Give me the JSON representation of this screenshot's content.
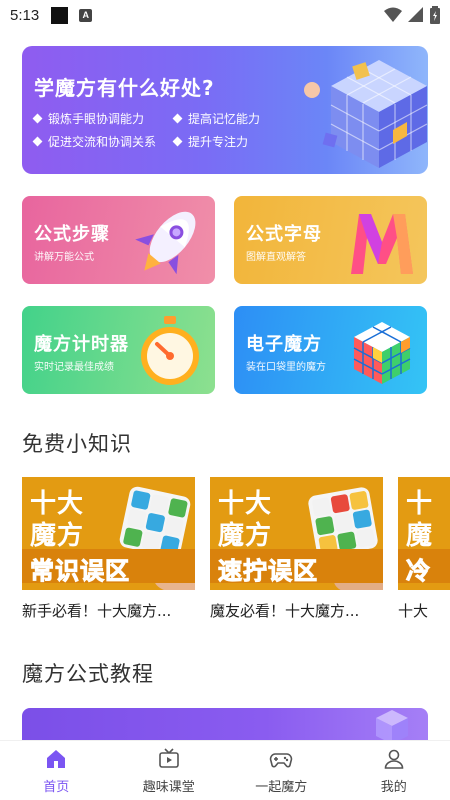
{
  "status_bar": {
    "time": "5:13",
    "notif_badge": "A"
  },
  "hero": {
    "title": "学魔方有什么好处?",
    "benefits": [
      "锻炼手眼协调能力",
      "提高记忆能力",
      "促进交流和协调关系",
      "提升专注力"
    ]
  },
  "features": [
    {
      "title": "公式步骤",
      "subtitle": "讲解万能公式",
      "icon": "rocket-icon"
    },
    {
      "title": "公式字母",
      "subtitle": "图解直观解答",
      "icon": "letter-m-icon"
    },
    {
      "title": "魔方计时器",
      "subtitle": "实时记录最佳成绩",
      "icon": "stopwatch-icon"
    },
    {
      "title": "电子魔方",
      "subtitle": "装在口袋里的魔方",
      "icon": "cube-icon"
    }
  ],
  "section_tips": {
    "title": "免费小知识"
  },
  "tips": [
    {
      "line1": "十大",
      "line2": "魔方",
      "banner": "常识误区",
      "caption": "新手必看！十大魔方..."
    },
    {
      "line1": "十大",
      "line2": "魔方",
      "banner": "速拧误区",
      "caption": "魔友必看！十大魔方..."
    },
    {
      "line1": "十",
      "line2": "魔",
      "banner": "冷",
      "caption": "十大"
    }
  ],
  "section_tutorial": {
    "title": "魔方公式教程"
  },
  "tabbar": {
    "items": [
      {
        "label": "首页",
        "icon": "home-icon",
        "active": true
      },
      {
        "label": "趣味课堂",
        "icon": "tv-icon",
        "active": false
      },
      {
        "label": "一起魔方",
        "icon": "gamepad-icon",
        "active": false
      },
      {
        "label": "我的",
        "icon": "user-icon",
        "active": false
      }
    ]
  },
  "colors": {
    "accent": "#7b55f2",
    "hero_start": "#8f5cf0",
    "hero_end": "#8fb6fb"
  }
}
